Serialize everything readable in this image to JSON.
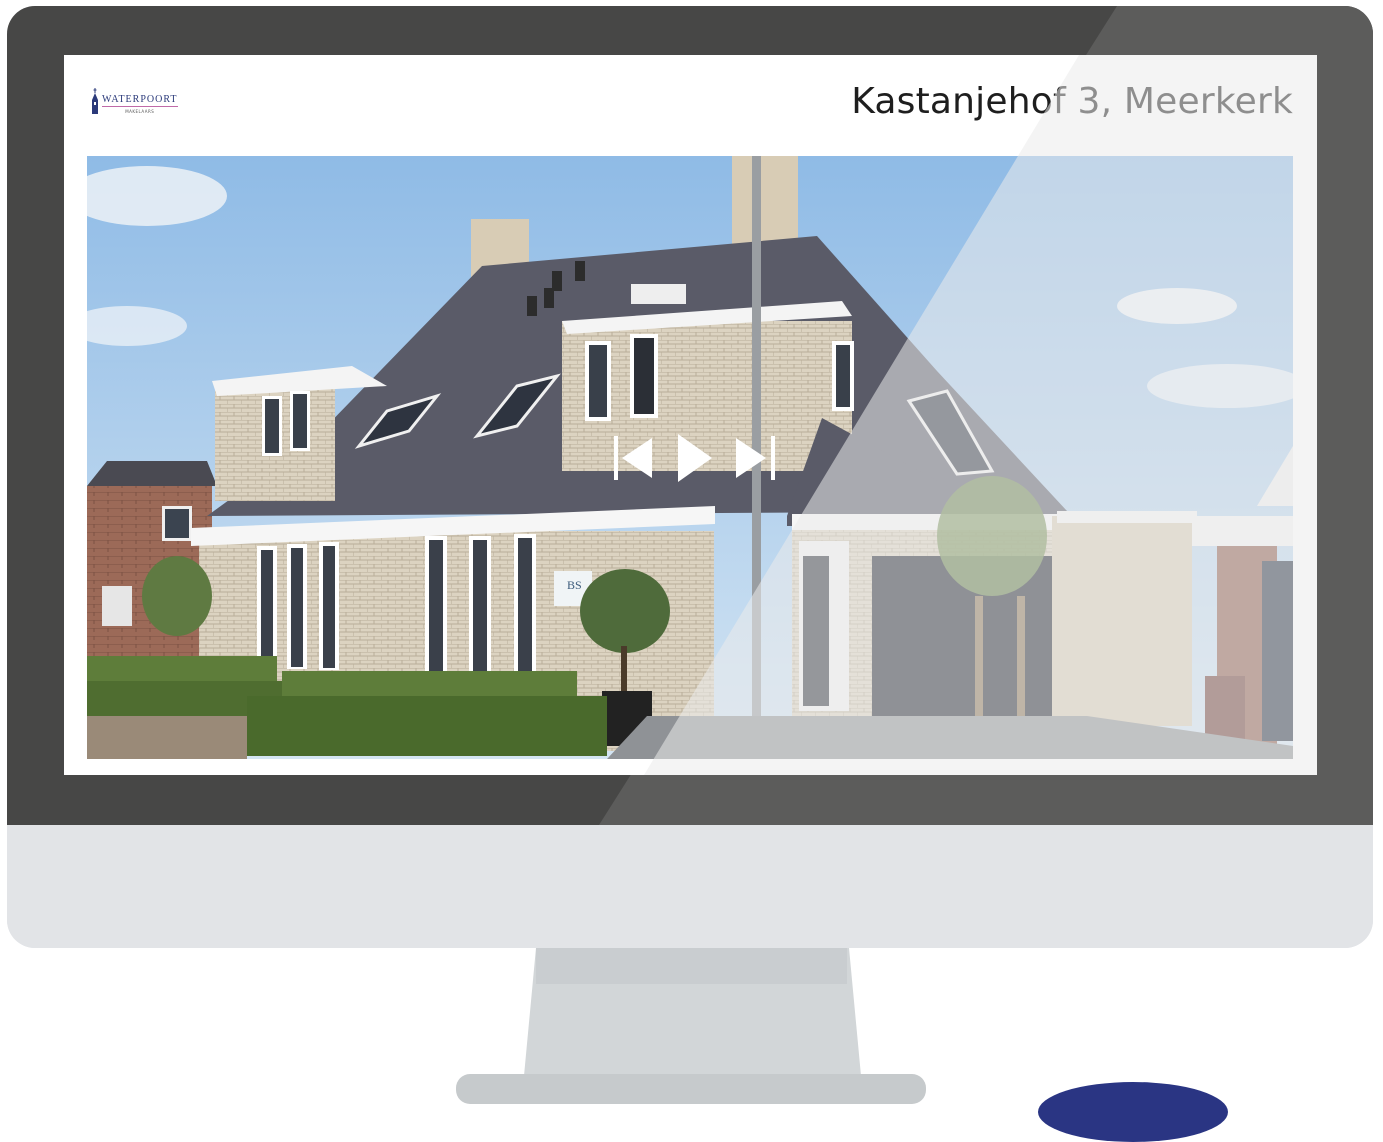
{
  "page": {
    "title": "Kastanjehof 3, Meerkerk",
    "logo": {
      "name": "WATERPOORT",
      "subtitle": "MAKELAARS",
      "icon": "church-tower-icon"
    }
  },
  "slideshow": {
    "image": "house-photo",
    "controls": [
      {
        "name": "previous",
        "icon": "skip-previous-icon"
      },
      {
        "name": "play",
        "icon": "play-icon"
      },
      {
        "name": "next",
        "icon": "skip-next-icon"
      }
    ]
  },
  "colors": {
    "bezel": "#474746",
    "chin": "#e2e4e7",
    "stand": "#d2d6d8",
    "brand": "#2b3a7a",
    "badge": "#2a3583"
  }
}
